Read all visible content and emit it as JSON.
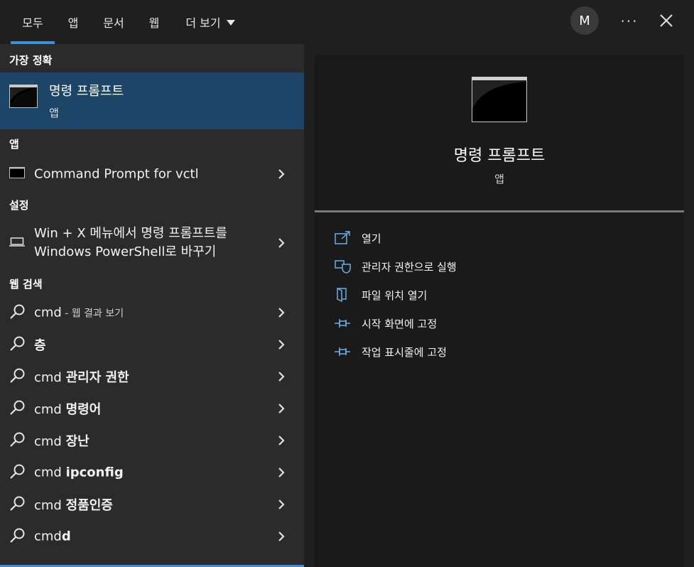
{
  "tabs": [
    {
      "label": "모두"
    },
    {
      "label": "앱"
    },
    {
      "label": "문서"
    },
    {
      "label": "웹"
    },
    {
      "label": "더 보기"
    }
  ],
  "avatar_initial": "M",
  "more_glyph": "···",
  "left": {
    "best_match_header": "가장 정확",
    "best_match": {
      "title": "명령 프롬프트",
      "subtitle": "앱"
    },
    "apps_header": "앱",
    "apps": [
      {
        "label": "Command Prompt for vctl"
      }
    ],
    "settings_header": "설정",
    "settings": [
      {
        "line1": "Win + X 메뉴에서 명령 프롬프트를",
        "line2": "Windows PowerShell로 바꾸기"
      }
    ],
    "web_header": "웹 검색",
    "web_first": {
      "prefix": "cmd",
      "suffix": " - 웹 결과 보기"
    },
    "web_results": [
      {
        "normal": "",
        "bold": "층"
      },
      {
        "normal": "cmd ",
        "bold": "관리자 권한"
      },
      {
        "normal": "cmd ",
        "bold": "명령어"
      },
      {
        "normal": "cmd ",
        "bold": "장난"
      },
      {
        "normal": "cmd ",
        "bold": "ipconfig"
      },
      {
        "normal": "cmd ",
        "bold": "정품인증"
      },
      {
        "normal": "cmd",
        "bold": "d"
      }
    ]
  },
  "right": {
    "title": "명령 프롬프트",
    "subtitle": "앱",
    "actions": [
      {
        "label": "열기",
        "icon": "open-icon"
      },
      {
        "label": "관리자 권한으로 실행",
        "icon": "shield-icon"
      },
      {
        "label": "파일 위치 열기",
        "icon": "file-location-icon"
      },
      {
        "label": "시작 화면에 고정",
        "icon": "pin-icon"
      },
      {
        "label": "작업 표시줄에 고정",
        "icon": "pin-icon"
      }
    ]
  },
  "colors": {
    "accent": "#3f8fd8",
    "selected_bg": "#1d4568",
    "icon_blue": "#6aaee8"
  }
}
